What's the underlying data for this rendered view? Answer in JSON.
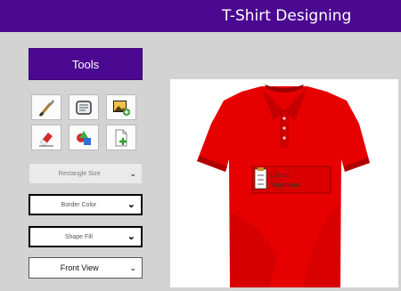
{
  "app": {
    "title": "T-Shirt Designing"
  },
  "toolbar": {
    "tools_label": "Tools",
    "tools": [
      {
        "name": "paintbrush-icon"
      },
      {
        "name": "text-box-icon"
      },
      {
        "name": "insert-image-icon"
      },
      {
        "name": "eraser-icon"
      },
      {
        "name": "shapes-icon"
      },
      {
        "name": "new-document-icon"
      }
    ]
  },
  "controls": {
    "rectangle_size": "Rectangle Size",
    "border_color": "Border Color",
    "shape_fill": "Shape Fill",
    "view": "Front View"
  },
  "canvas": {
    "shirt_color": "#e60000",
    "logo_text": "List of Shipments"
  },
  "colors": {
    "accent": "#4b0890",
    "background": "#d3d3d3"
  }
}
